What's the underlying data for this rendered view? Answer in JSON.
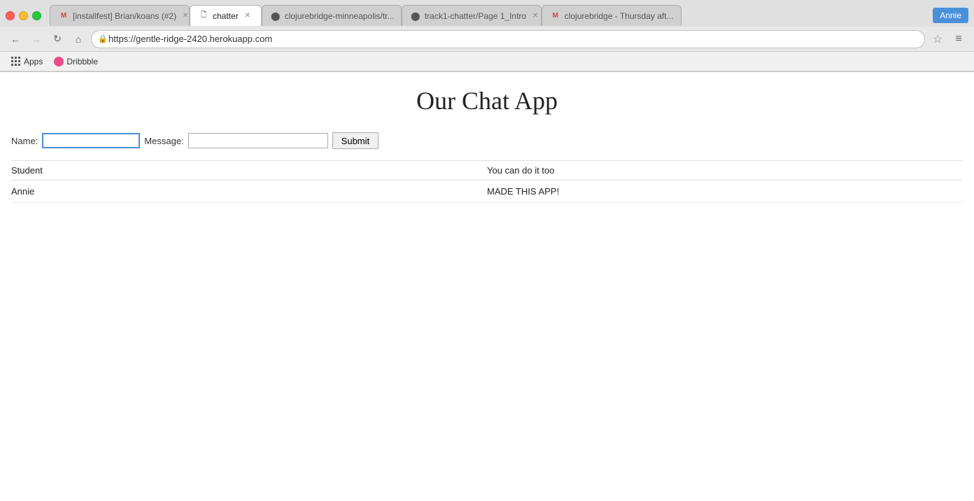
{
  "browser": {
    "tabs": [
      {
        "id": "tab-gmail",
        "label": "[installfest] Brian/koans (#2)",
        "favicon": "M",
        "favicon_color": "#d44638",
        "active": false
      },
      {
        "id": "tab-chatter",
        "label": "chatter",
        "favicon": "📄",
        "favicon_color": "#555",
        "active": true
      },
      {
        "id": "tab-github-clojure",
        "label": "clojurebridge-minneapolis/tr...",
        "favicon": "G",
        "favicon_color": "#333",
        "active": false
      },
      {
        "id": "tab-github-track",
        "label": "track1-chatter/Page 1_Intro",
        "favicon": "G",
        "favicon_color": "#333",
        "active": false
      },
      {
        "id": "tab-gmail2",
        "label": "clojurebridge - Thursday aft...",
        "favicon": "M",
        "favicon_color": "#d44638",
        "active": false
      }
    ],
    "user_label": "Annie",
    "url": "https://gentle-ridge-2420.herokuapp.com",
    "back_enabled": true,
    "forward_enabled": false,
    "bookmarks": [
      {
        "label": "Apps",
        "type": "apps"
      },
      {
        "label": "Dribbble",
        "type": "dribbble"
      }
    ]
  },
  "page": {
    "title": "Our Chat App",
    "form": {
      "name_label": "Name:",
      "name_placeholder": "",
      "message_label": "Message:",
      "message_placeholder": "",
      "submit_label": "Submit"
    },
    "table": {
      "col_student": "Student",
      "col_message": "You can do it too",
      "rows": [
        {
          "student": "Annie",
          "message": "MADE THIS APP!"
        }
      ]
    }
  }
}
